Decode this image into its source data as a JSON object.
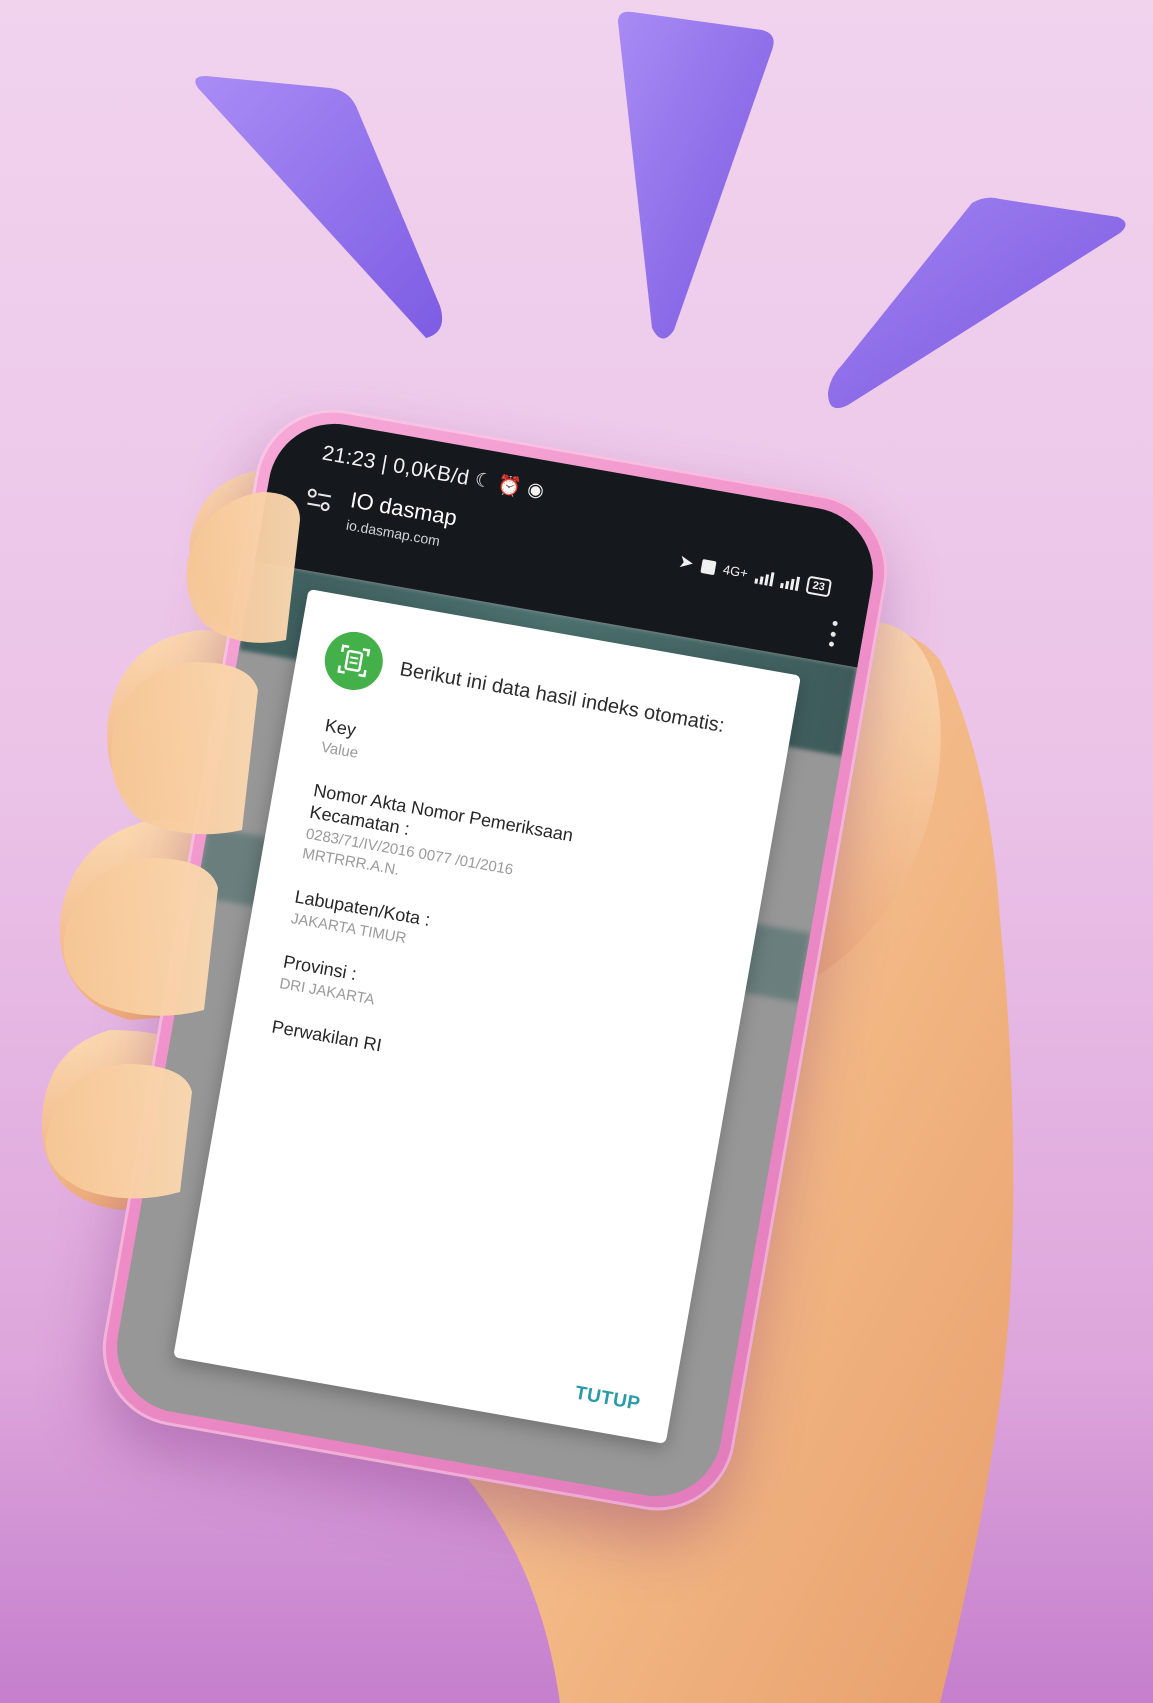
{
  "status_bar": {
    "time_speed": "21:23 | 0,0KB/d",
    "icons_left": [
      "moon-icon",
      "alarm-icon",
      "circle-badge-icon"
    ],
    "network_label": "4G+",
    "battery": "23",
    "icons_right": [
      "location-arrow-icon",
      "volte-icon",
      "signal-icon",
      "battery-icon"
    ]
  },
  "browser": {
    "site_title": "IO dasmap",
    "site_url": "io.dasmap.com"
  },
  "dialog": {
    "title": "Berikut ini data hasil indeks otomatis:",
    "fields": [
      {
        "key": "Key",
        "value": "Value"
      },
      {
        "key": "Nomor Akta Nomor Pemeriksaan Kecamatan :",
        "value": "0283/71/IV/2016 0077 /01/2016 MRTRRR.A.N."
      },
      {
        "key": "Labupaten/Kota :",
        "value": "JAKARTA TIMUR"
      },
      {
        "key": "Provinsi :",
        "value": "DRI JAKARTA"
      },
      {
        "key": "Perwakilan RI",
        "value": ""
      }
    ],
    "close_label": "TUTUP"
  },
  "colors": {
    "background": "#ebc3e8",
    "ray": "#8f6ee9",
    "phone_frame": "#ef8fc9",
    "topbar": "#15191d",
    "dialog_icon": "#43b049",
    "close_button": "#2a9aa6"
  }
}
